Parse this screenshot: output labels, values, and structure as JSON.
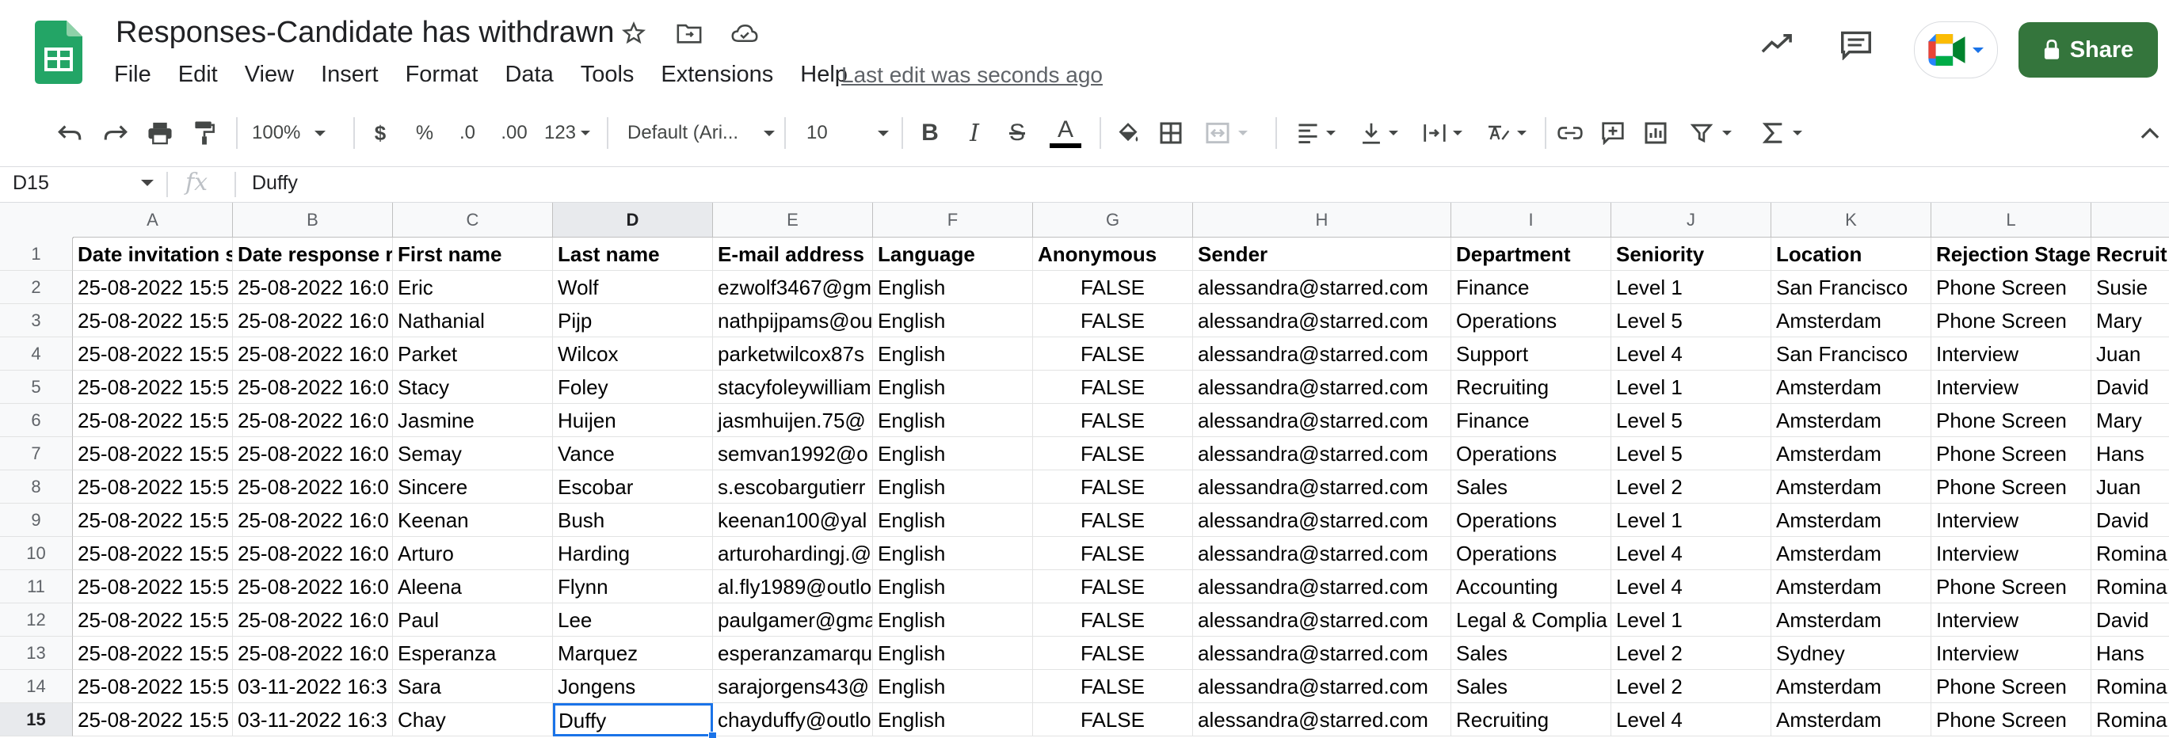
{
  "title": "Responses-Candidate has withdrawn",
  "menu": [
    "File",
    "Edit",
    "View",
    "Insert",
    "Format",
    "Data",
    "Tools",
    "Extensions",
    "Help"
  ],
  "last_edit": "Last edit was seconds ago",
  "share_label": "Share",
  "toolbar": {
    "zoom": "100%",
    "currency": "$",
    "percent": "%",
    "dec_decrease": ".0",
    "dec_increase": ".00",
    "more_formats": "123",
    "font": "Default (Ari...",
    "font_size": "10",
    "bold": "B",
    "italic": "I",
    "strike": "S",
    "text_color": "A"
  },
  "name_box": "D15",
  "fx_label": "fx",
  "formula_value": "Duffy",
  "colors": {
    "accent": "#1a73e8",
    "share": "#34753c",
    "logo": "#23a566"
  },
  "columns": [
    "A",
    "B",
    "C",
    "D",
    "E",
    "F",
    "G",
    "H",
    "I",
    "J",
    "K",
    "L"
  ],
  "rows": [
    [
      "Date invitation s",
      "Date response r",
      "First name",
      "Last name",
      "E-mail address",
      "Language",
      "Anonymous",
      "Sender",
      "Department",
      "Seniority",
      "Location",
      "Rejection Stage",
      "Recruit"
    ],
    [
      "25-08-2022 15:5",
      "25-08-2022 16:0",
      "Eric",
      "Wolf",
      "ezwolf3467@gm",
      "English",
      "FALSE",
      "alessandra@starred.com",
      "Finance",
      "Level 1",
      "San Francisco",
      "Phone Screen",
      "Susie"
    ],
    [
      "25-08-2022 15:5",
      "25-08-2022 16:0",
      "Nathanial",
      "Pijp",
      "nathpijpams@ou",
      "English",
      "FALSE",
      "alessandra@starred.com",
      "Operations",
      "Level 5",
      "Amsterdam",
      "Phone Screen",
      "Mary"
    ],
    [
      "25-08-2022 15:5",
      "25-08-2022 16:0",
      "Parket",
      "Wilcox",
      "parketwilcox87s",
      "English",
      "FALSE",
      "alessandra@starred.com",
      "Support",
      "Level 4",
      "San Francisco",
      "Interview",
      "Juan"
    ],
    [
      "25-08-2022 15:5",
      "25-08-2022 16:0",
      "Stacy",
      "Foley",
      "stacyfoleywilliam",
      "English",
      "FALSE",
      "alessandra@starred.com",
      "Recruiting",
      "Level 1",
      "Amsterdam",
      "Interview",
      "David"
    ],
    [
      "25-08-2022 15:5",
      "25-08-2022 16:0",
      "Jasmine",
      "Huijen",
      "jasmhuijen.75@",
      "English",
      "FALSE",
      "alessandra@starred.com",
      "Finance",
      "Level 5",
      "Amsterdam",
      "Phone Screen",
      "Mary"
    ],
    [
      "25-08-2022 15:5",
      "25-08-2022 16:0",
      "Semay",
      "Vance",
      "semvan1992@o",
      "English",
      "FALSE",
      "alessandra@starred.com",
      "Operations",
      "Level 5",
      "Amsterdam",
      "Phone Screen",
      "Hans"
    ],
    [
      "25-08-2022 15:5",
      "25-08-2022 16:0",
      "Sincere",
      "Escobar",
      "s.escobargutierr",
      "English",
      "FALSE",
      "alessandra@starred.com",
      "Sales",
      "Level 2",
      "Amsterdam",
      "Phone Screen",
      "Juan"
    ],
    [
      "25-08-2022 15:5",
      "25-08-2022 16:0",
      "Keenan",
      "Bush",
      "keenan100@yal",
      "English",
      "FALSE",
      "alessandra@starred.com",
      "Operations",
      "Level 1",
      "Amsterdam",
      "Interview",
      "David"
    ],
    [
      "25-08-2022 15:5",
      "25-08-2022 16:0",
      "Arturo",
      "Harding",
      "arturohardingj.@",
      "English",
      "FALSE",
      "alessandra@starred.com",
      "Operations",
      "Level 4",
      "Amsterdam",
      "Interview",
      "Romina"
    ],
    [
      "25-08-2022 15:5",
      "25-08-2022 16:0",
      "Aleena",
      "Flynn",
      "al.fly1989@outlo",
      "English",
      "FALSE",
      "alessandra@starred.com",
      "Accounting",
      "Level 4",
      "Amsterdam",
      "Phone Screen",
      "Romina"
    ],
    [
      "25-08-2022 15:5",
      "25-08-2022 16:0",
      "Paul",
      "Lee",
      "paulgamer@gma",
      "English",
      "FALSE",
      "alessandra@starred.com",
      "Legal & Complia",
      "Level 1",
      "Amsterdam",
      "Interview",
      "David"
    ],
    [
      "25-08-2022 15:5",
      "25-08-2022 16:0",
      "Esperanza",
      "Marquez",
      "esperanzamarqu",
      "English",
      "FALSE",
      "alessandra@starred.com",
      "Sales",
      "Level 2",
      "Sydney",
      "Interview",
      "Hans"
    ],
    [
      "25-08-2022 15:5",
      "03-11-2022 16:3",
      "Sara",
      "Jongens",
      "sarajorgens43@",
      "English",
      "FALSE",
      "alessandra@starred.com",
      "Sales",
      "Level 2",
      "Amsterdam",
      "Phone Screen",
      "Romina"
    ],
    [
      "25-08-2022 15:5",
      "03-11-2022 16:3",
      "Chay",
      "Duffy",
      "chayduffy@outlo",
      "English",
      "FALSE",
      "alessandra@starred.com",
      "Recruiting",
      "Level 4",
      "Amsterdam",
      "Phone Screen",
      "Romina"
    ]
  ]
}
